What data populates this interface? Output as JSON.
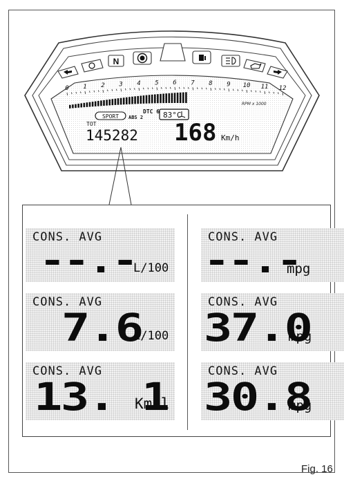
{
  "dashboard": {
    "tick_labels": [
      "0",
      "1",
      "2",
      "3",
      "4",
      "5",
      "6",
      "7",
      "8",
      "9",
      "10",
      "11",
      "12"
    ],
    "rpm_label": "RPM x 1000",
    "mode": "SPORT",
    "dtc": "DTC 6",
    "abs": "ABS 2",
    "temperature": "83°C",
    "odometer_label": "TOT",
    "odometer": "145282",
    "speed": "168",
    "speed_unit": "Km/h",
    "neutral": "N",
    "icons": [
      "left-turn-icon",
      "immobilizer-icon",
      "neutral-icon",
      "abs-warning-icon",
      "fuel-icon",
      "high-beam-icon",
      "oil-pressure-icon",
      "right-turn-icon"
    ]
  },
  "panels": {
    "left": [
      {
        "caption": "CONS. AVG",
        "value": "--.-",
        "unit": "L/100"
      },
      {
        "caption": "CONS. AVG",
        "value": "7.6",
        "unit": "L/100"
      },
      {
        "caption": "CONS. AVG",
        "value": "13. 1",
        "unit": "Km/l"
      }
    ],
    "right": [
      {
        "caption": "CONS. AVG",
        "value": "--.-",
        "unit": "mpg"
      },
      {
        "caption": "CONS. AVG",
        "value": "37.0",
        "unit": "mpg"
      },
      {
        "caption": "CONS. AVG",
        "value": "30.8",
        "unit": "mpg"
      }
    ]
  },
  "figure_label": "Fig. 16"
}
